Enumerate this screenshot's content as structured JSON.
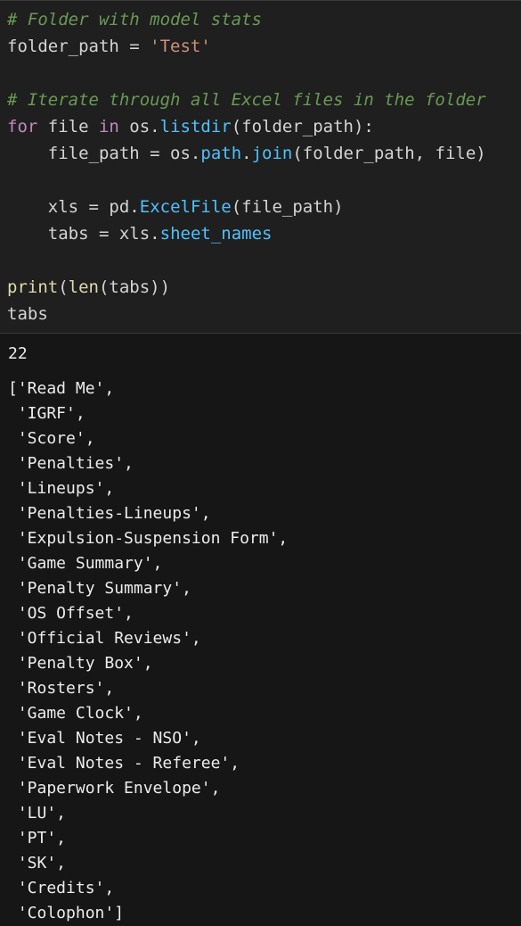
{
  "code": {
    "comment1": "# Folder with model stats",
    "line_folder": {
      "var": "folder_path",
      "op": " = ",
      "value": "'Test'"
    },
    "comment2": "# Iterate through all Excel files in the folder",
    "line_for": {
      "kw_for": "for",
      "var_file": " file ",
      "kw_in": "in",
      "obj": " os.",
      "fn": "listdir",
      "args": "(folder_path):"
    },
    "line_filepath": {
      "indent": "    ",
      "var": "file_path",
      "op": " = ",
      "obj": "os.",
      "attr_path": "path",
      "dot": ".",
      "fn": "join",
      "args": "(folder_path, file)"
    },
    "line_xls": {
      "indent": "    ",
      "var": "xls",
      "op": " = ",
      "obj": "pd.",
      "fn": "ExcelFile",
      "args": "(file_path)"
    },
    "line_tabs": {
      "indent": "    ",
      "var": "tabs",
      "op": " = ",
      "obj": "xls.",
      "attr": "sheet_names"
    },
    "line_print": {
      "fn_print": "print",
      "p1": "(",
      "fn_len": "len",
      "args": "(tabs))"
    },
    "line_last": "tabs"
  },
  "output": {
    "count": "22",
    "list_lines": [
      "['Read Me',",
      " 'IGRF',",
      " 'Score',",
      " 'Penalties',",
      " 'Lineups',",
      " 'Penalties-Lineups',",
      " 'Expulsion-Suspension Form',",
      " 'Game Summary',",
      " 'Penalty Summary',",
      " 'OS Offset',",
      " 'Official Reviews',",
      " 'Penalty Box',",
      " 'Rosters',",
      " 'Game Clock',",
      " 'Eval Notes - NSO',",
      " 'Eval Notes - Referee',",
      " 'Paperwork Envelope',",
      " 'LU',",
      " 'PT',",
      " 'SK',",
      " 'Credits',",
      " 'Colophon']"
    ]
  }
}
